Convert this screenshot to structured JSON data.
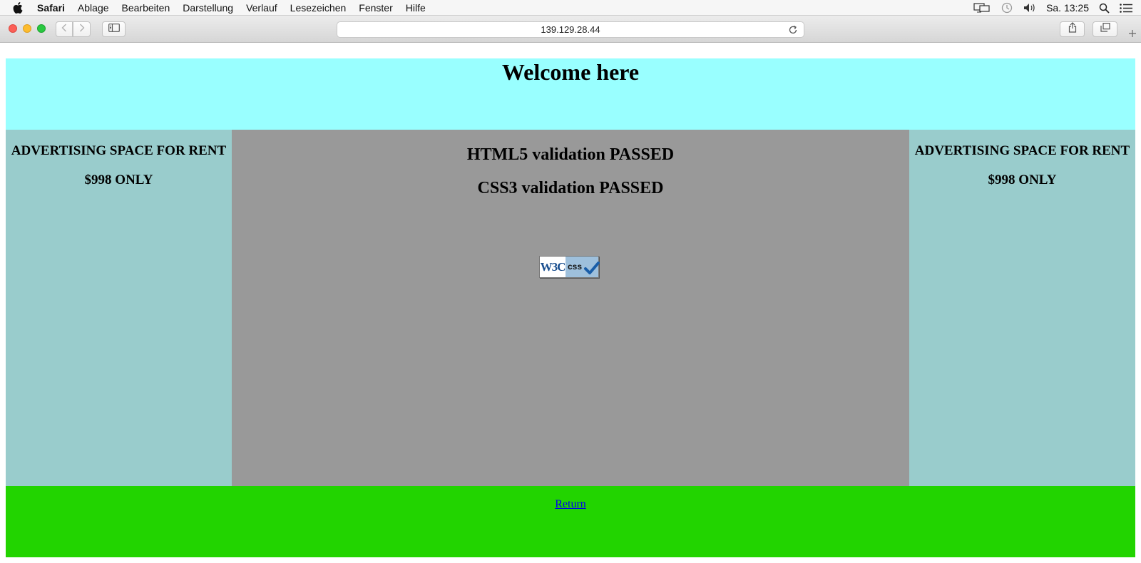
{
  "menubar": {
    "app_name": "Safari",
    "items": [
      "Ablage",
      "Bearbeiten",
      "Darstellung",
      "Verlauf",
      "Lesezeichen",
      "Fenster",
      "Hilfe"
    ],
    "clock": "Sa. 13:25"
  },
  "toolbar": {
    "url": "139.129.28.44"
  },
  "page": {
    "heading": "Welcome here",
    "left_ad": {
      "title": "ADVERTISING SPACE FOR RENT",
      "price": "$998 ONLY"
    },
    "right_ad": {
      "title": "ADVERTISING SPACE FOR RENT",
      "price": "$998 ONLY"
    },
    "validation": {
      "html5": "HTML5 validation PASSED",
      "css3": "CSS3 validation PASSED"
    },
    "badge": {
      "logo_text": "W3C",
      "label": "css"
    },
    "footer_link": "Return"
  },
  "colors": {
    "header_bg": "#99ffff",
    "aside_bg": "#99cccc",
    "main_bg": "#999999",
    "footer_bg": "#22d400",
    "link": "#0000ee"
  }
}
